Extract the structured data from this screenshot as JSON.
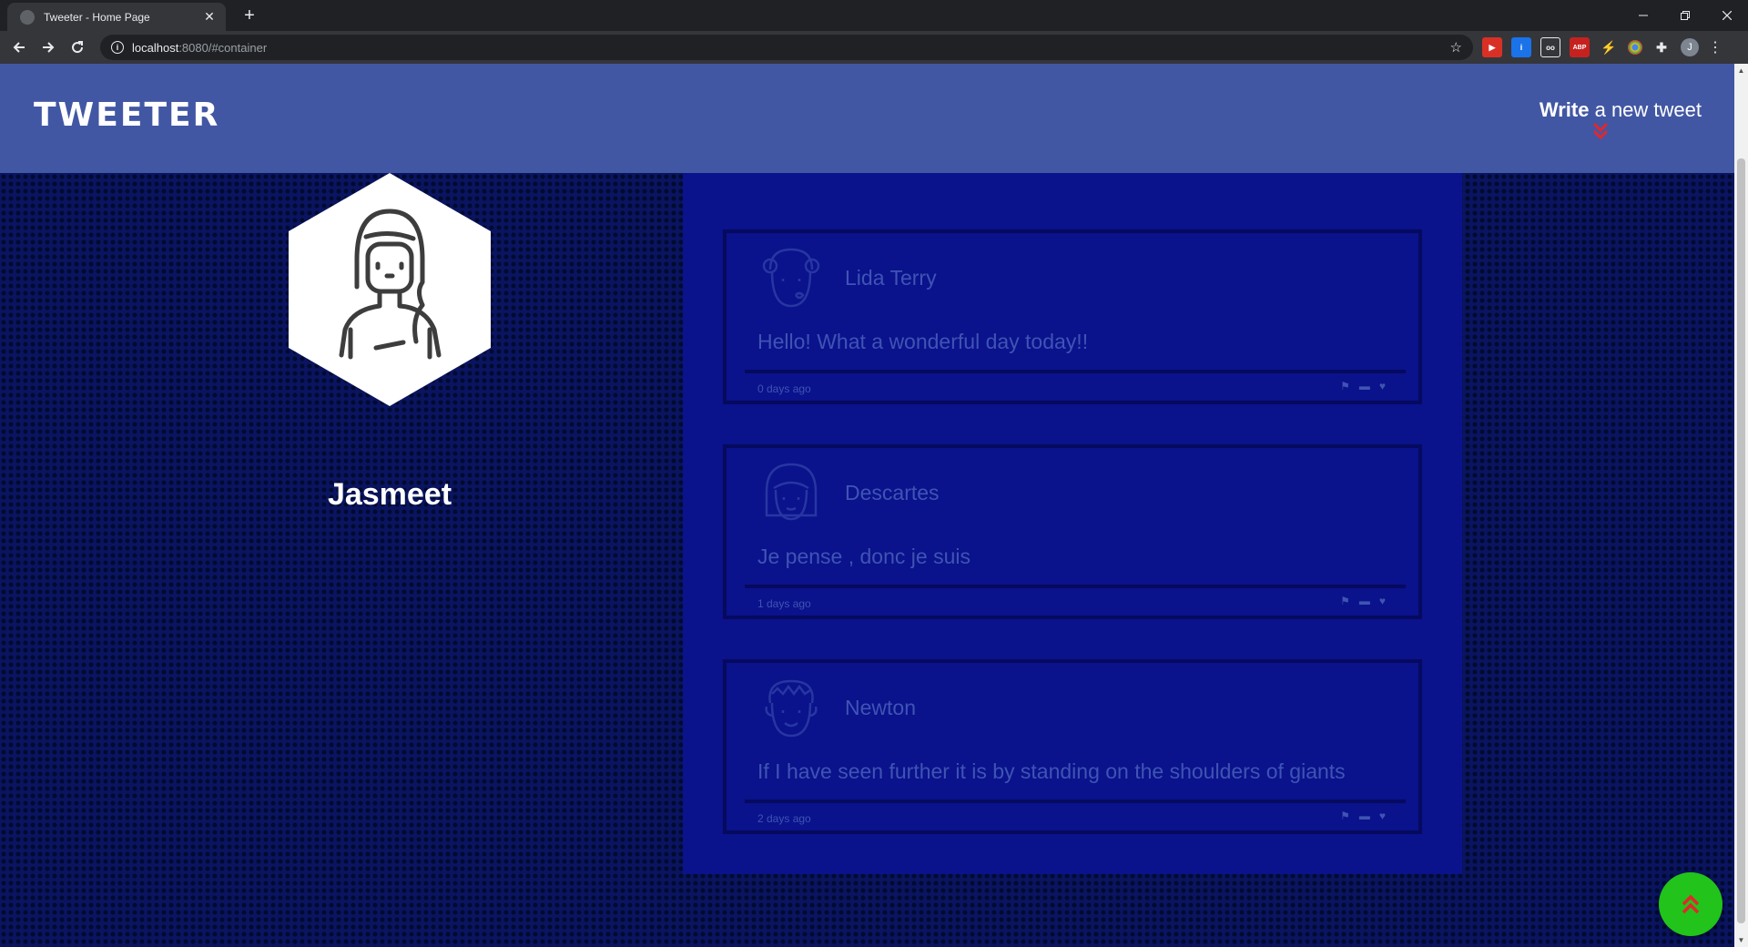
{
  "browser": {
    "tab_title": "Tweeter - Home Page",
    "new_tab_label": "+",
    "close_tab_label": "✕",
    "url_host": "localhost",
    "url_rest": ":8080/#container",
    "profile_initial": "J",
    "extensions": [
      "pdf-icon",
      "info-icon",
      "glasses-icon",
      "ABP",
      "acrobat-icon",
      "chrome-icon",
      "puzzle-icon"
    ]
  },
  "header": {
    "logo": "TWEETER",
    "compose_strong": "Write",
    "compose_rest": " a new tweet"
  },
  "profile": {
    "name": "Jasmeet"
  },
  "tweets": [
    {
      "author": "Lida Terry",
      "text": "Hello! What a wonderful day today!!",
      "time": "0 days ago"
    },
    {
      "author": "Descartes",
      "text": "Je pense , donc je suis",
      "time": "1 days ago"
    },
    {
      "author": "Newton",
      "text": "If I have seen further it is by standing on the shoulders of giants",
      "time": "2 days ago"
    }
  ],
  "colors": {
    "header_bg": "#4257a4",
    "page_bg": "#0a1460",
    "feed_bg": "#0a128c",
    "tweet_text": "#3f54b3",
    "fab_bg": "#22c31a",
    "fab_icon": "#e3262c"
  }
}
